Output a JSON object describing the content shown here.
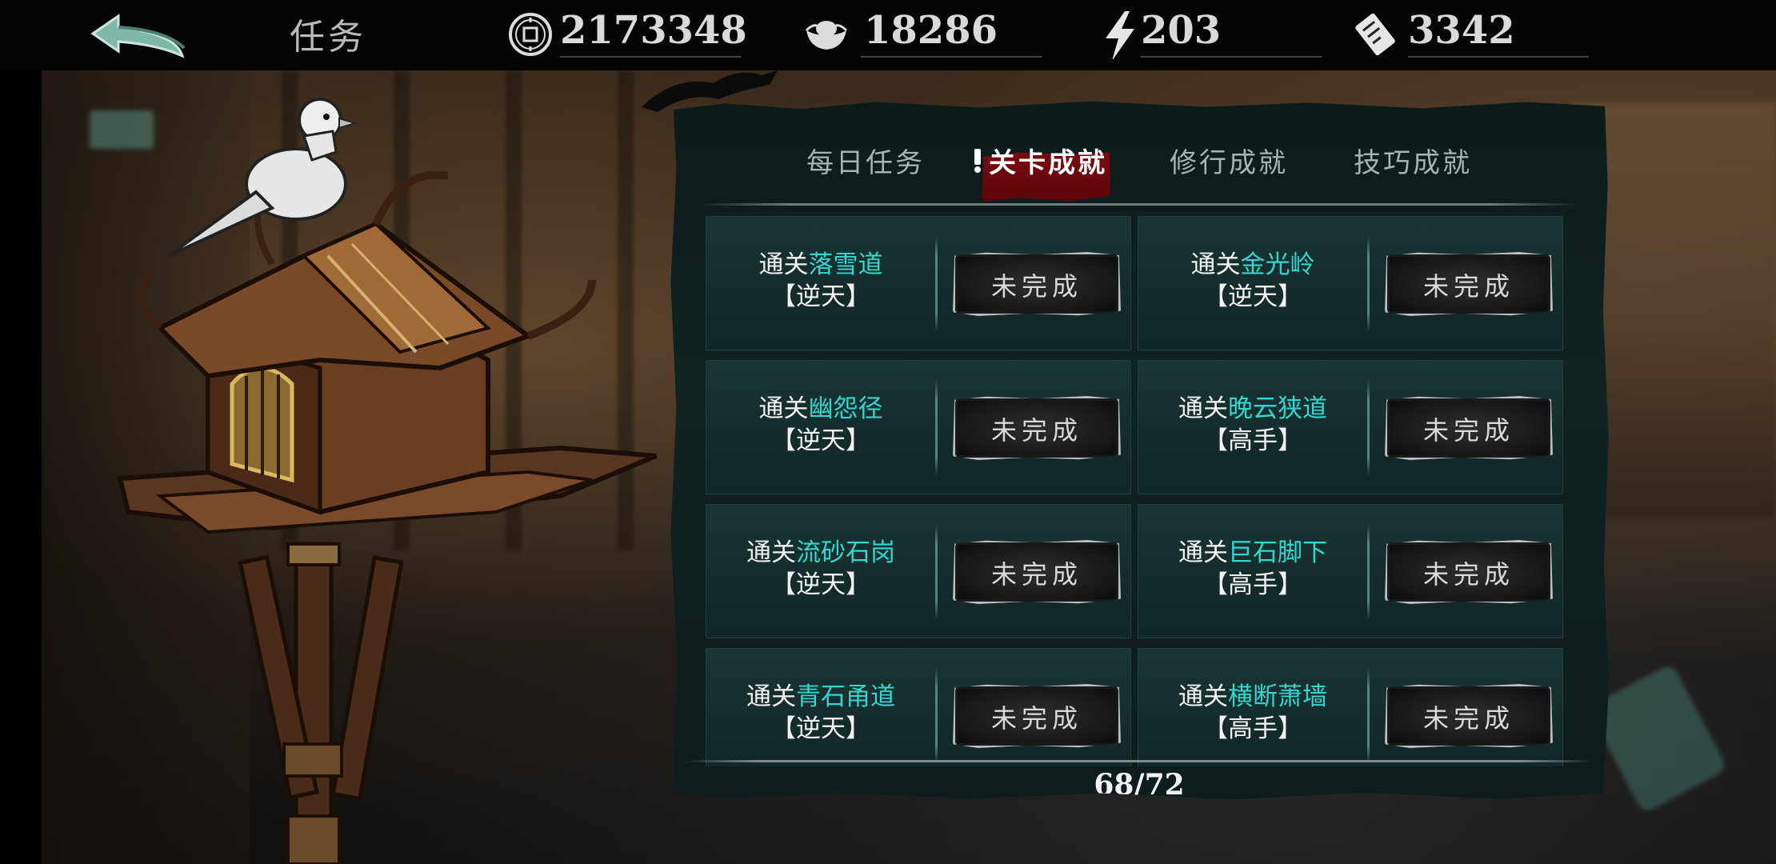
{
  "header": {
    "title": "任务",
    "resources": [
      {
        "icon": "coin-icon",
        "value": "2173348"
      },
      {
        "icon": "silver-ingot-icon",
        "value": "18286"
      },
      {
        "icon": "lightning-icon",
        "value": "203"
      },
      {
        "icon": "ticket-icon",
        "value": "3342"
      }
    ]
  },
  "tabs": [
    {
      "label": "每日任务",
      "active": false
    },
    {
      "label": "关卡成就",
      "active": true
    },
    {
      "label": "修行成就",
      "active": false
    },
    {
      "label": "技巧成就",
      "active": false
    }
  ],
  "tasks": [
    {
      "prefix": "通关",
      "stage": "落雪道",
      "level": "【逆天】",
      "status": "未完成"
    },
    {
      "prefix": "通关",
      "stage": "金光岭",
      "level": "【逆天】",
      "status": "未完成"
    },
    {
      "prefix": "通关",
      "stage": "幽怨径",
      "level": "【逆天】",
      "status": "未完成"
    },
    {
      "prefix": "通关",
      "stage": "晚云狭道",
      "level": "【高手】",
      "status": "未完成"
    },
    {
      "prefix": "通关",
      "stage": "流砂石岗",
      "level": "【逆天】",
      "status": "未完成"
    },
    {
      "prefix": "通关",
      "stage": "巨石脚下",
      "level": "【高手】",
      "status": "未完成"
    },
    {
      "prefix": "通关",
      "stage": "青石甬道",
      "level": "【逆天】",
      "status": "未完成"
    },
    {
      "prefix": "通关",
      "stage": "横断萧墙",
      "level": "【高手】",
      "status": "未完成"
    }
  ],
  "progress": "68/72",
  "colors": {
    "highlight": "#33d6d0",
    "active_tab": "#7a0b10",
    "panel": "#102222"
  }
}
